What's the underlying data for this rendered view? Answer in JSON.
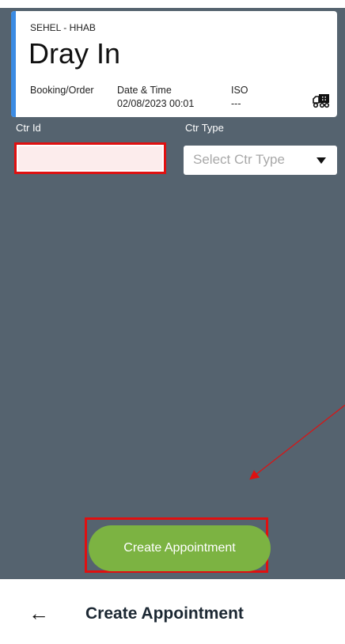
{
  "card": {
    "facility": "SEHEL - HHAB",
    "title": "Dray In",
    "booking_label": "Booking/Order",
    "datetime_label": "Date & Time",
    "datetime_value": "02/08/2023 00:01",
    "iso_label": "ISO",
    "iso_value": "---",
    "icon": "truck-icon"
  },
  "form": {
    "ctr_id_label": "Ctr Id",
    "ctr_id_value": "",
    "ctr_type_label": "Ctr Type",
    "ctr_type_placeholder": "Select Ctr Type"
  },
  "create_button_label": "Create Appointment",
  "bottom_bar": {
    "back_icon": "back-arrow-icon",
    "title": "Create Appointment"
  },
  "colors": {
    "background": "#55636f",
    "accent": "#3b8be3",
    "button": "#7cb342",
    "highlight": "#e01010"
  }
}
